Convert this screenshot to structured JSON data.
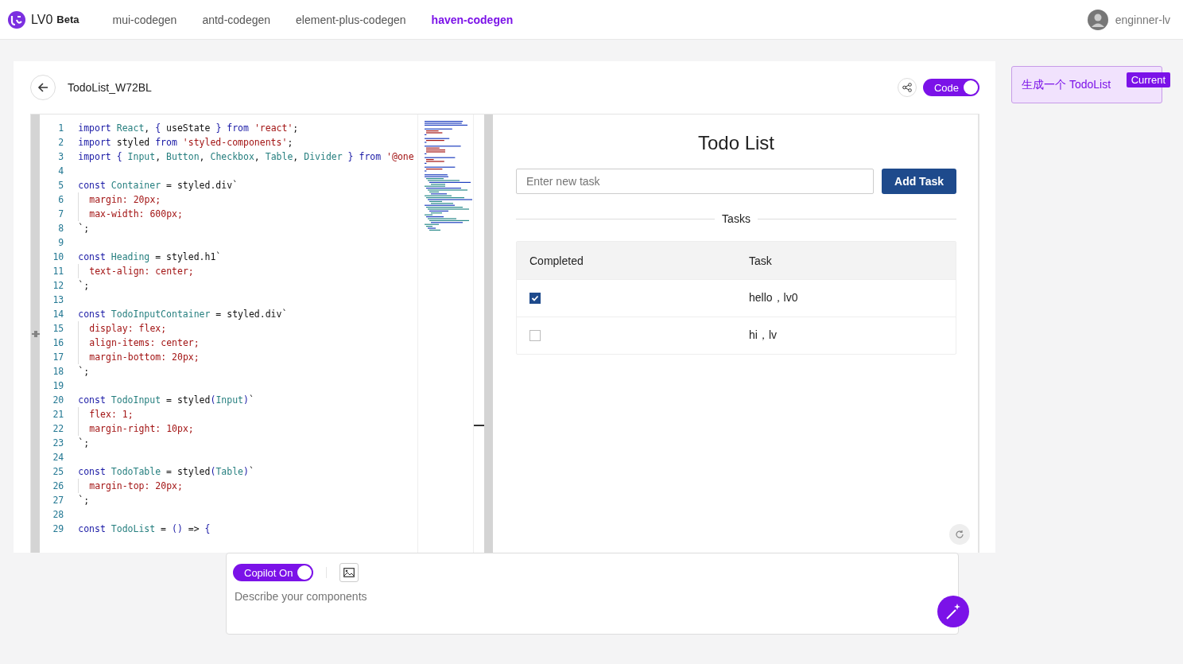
{
  "header": {
    "logo_text": "LV0",
    "logo_badge": "Beta",
    "nav": [
      {
        "label": "mui-codegen",
        "selected": false
      },
      {
        "label": "antd-codegen",
        "selected": false
      },
      {
        "label": "element-plus-codegen",
        "selected": false
      },
      {
        "label": "haven-codegen",
        "selected": true
      }
    ],
    "user": {
      "name": "enginner-lv"
    }
  },
  "workspace": {
    "title": "TodoList_W72BL",
    "code_toggle": {
      "label": "Code",
      "on": true
    },
    "editor": {
      "lines": [
        {
          "n": "1",
          "guide": false,
          "tokens": [
            {
              "kind": "keyword",
              "text": "import"
            },
            {
              "kind": "type",
              "text": " React"
            },
            {
              "kind": "plain",
              "text": ", "
            },
            {
              "kind": "keyword",
              "text": "{"
            },
            {
              "kind": "plain",
              "text": " useState "
            },
            {
              "kind": "keyword",
              "text": "}"
            },
            {
              "kind": "keyword",
              "text": " from"
            },
            {
              "kind": "string",
              "text": " 'react'"
            },
            {
              "kind": "plain",
              "text": ";"
            }
          ]
        },
        {
          "n": "2",
          "guide": false,
          "tokens": [
            {
              "kind": "keyword",
              "text": "import"
            },
            {
              "kind": "plain",
              "text": " styled "
            },
            {
              "kind": "keyword",
              "text": "from"
            },
            {
              "kind": "string",
              "text": " 'styled-components'"
            },
            {
              "kind": "plain",
              "text": ";"
            }
          ]
        },
        {
          "n": "3",
          "guide": false,
          "tokens": [
            {
              "kind": "keyword",
              "text": "import"
            },
            {
              "kind": "keyword",
              "text": " {"
            },
            {
              "kind": "type",
              "text": " Input"
            },
            {
              "kind": "plain",
              "text": ", "
            },
            {
              "kind": "type",
              "text": "Button"
            },
            {
              "kind": "plain",
              "text": ", "
            },
            {
              "kind": "type",
              "text": "Checkbox"
            },
            {
              "kind": "plain",
              "text": ", "
            },
            {
              "kind": "type",
              "text": "Table"
            },
            {
              "kind": "plain",
              "text": ", "
            },
            {
              "kind": "type",
              "text": "Divider"
            },
            {
              "kind": "keyword",
              "text": " }"
            },
            {
              "kind": "keyword",
              "text": " from"
            },
            {
              "kind": "string",
              "text": " '@one"
            }
          ]
        },
        {
          "n": "4",
          "guide": false
        },
        {
          "n": "5",
          "guide": false,
          "tokens": [
            {
              "kind": "keyword",
              "text": "const"
            },
            {
              "kind": "type",
              "text": " Container"
            },
            {
              "kind": "plain",
              "text": " = styled.div`"
            }
          ]
        },
        {
          "n": "6",
          "guide": true,
          "tokens": [
            {
              "kind": "string",
              "text": "margin: 20px;"
            }
          ]
        },
        {
          "n": "7",
          "guide": true,
          "tokens": [
            {
              "kind": "string",
              "text": "max-width: 600px;"
            }
          ]
        },
        {
          "n": "8",
          "guide": false,
          "tokens": [
            {
              "kind": "plain",
              "text": "`;"
            }
          ]
        },
        {
          "n": "9",
          "guide": false
        },
        {
          "n": "10",
          "guide": false,
          "tokens": [
            {
              "kind": "keyword",
              "text": "const"
            },
            {
              "kind": "type",
              "text": " Heading"
            },
            {
              "kind": "plain",
              "text": " = styled.h1`"
            }
          ]
        },
        {
          "n": "11",
          "guide": true,
          "tokens": [
            {
              "kind": "string",
              "text": "text-align: center;"
            }
          ]
        },
        {
          "n": "12",
          "guide": false,
          "tokens": [
            {
              "kind": "plain",
              "text": "`;"
            }
          ]
        },
        {
          "n": "13",
          "guide": false
        },
        {
          "n": "14",
          "guide": false,
          "tokens": [
            {
              "kind": "keyword",
              "text": "const"
            },
            {
              "kind": "type",
              "text": " TodoInputContainer"
            },
            {
              "kind": "plain",
              "text": " = styled.div`"
            }
          ]
        },
        {
          "n": "15",
          "guide": true,
          "tokens": [
            {
              "kind": "string",
              "text": "display: flex;"
            }
          ]
        },
        {
          "n": "16",
          "guide": true,
          "tokens": [
            {
              "kind": "string",
              "text": "align-items: center;"
            }
          ]
        },
        {
          "n": "17",
          "guide": true,
          "tokens": [
            {
              "kind": "string",
              "text": "margin-bottom: 20px;"
            }
          ]
        },
        {
          "n": "18",
          "guide": false,
          "tokens": [
            {
              "kind": "plain",
              "text": "`;"
            }
          ]
        },
        {
          "n": "19",
          "guide": false
        },
        {
          "n": "20",
          "guide": false,
          "tokens": [
            {
              "kind": "keyword",
              "text": "const"
            },
            {
              "kind": "type",
              "text": " TodoInput"
            },
            {
              "kind": "plain",
              "text": " = styled"
            },
            {
              "kind": "keyword",
              "text": "("
            },
            {
              "kind": "type",
              "text": "Input"
            },
            {
              "kind": "keyword",
              "text": ")"
            },
            {
              "kind": "plain",
              "text": "`"
            }
          ]
        },
        {
          "n": "21",
          "guide": true,
          "tokens": [
            {
              "kind": "string",
              "text": "flex: 1;"
            }
          ]
        },
        {
          "n": "22",
          "guide": true,
          "tokens": [
            {
              "kind": "string",
              "text": "margin-right: 10px;"
            }
          ]
        },
        {
          "n": "23",
          "guide": false,
          "tokens": [
            {
              "kind": "plain",
              "text": "`;"
            }
          ]
        },
        {
          "n": "24",
          "guide": false
        },
        {
          "n": "25",
          "guide": false,
          "tokens": [
            {
              "kind": "keyword",
              "text": "const"
            },
            {
              "kind": "type",
              "text": " TodoTable"
            },
            {
              "kind": "plain",
              "text": " = styled"
            },
            {
              "kind": "keyword",
              "text": "("
            },
            {
              "kind": "type",
              "text": "Table"
            },
            {
              "kind": "keyword",
              "text": ")"
            },
            {
              "kind": "plain",
              "text": "`"
            }
          ]
        },
        {
          "n": "26",
          "guide": true,
          "tokens": [
            {
              "kind": "string",
              "text": "margin-top: 20px;"
            }
          ]
        },
        {
          "n": "27",
          "guide": false,
          "tokens": [
            {
              "kind": "plain",
              "text": "`;"
            }
          ]
        },
        {
          "n": "28",
          "guide": false
        },
        {
          "n": "29",
          "guide": false,
          "tokens": [
            {
              "kind": "keyword",
              "text": "const"
            },
            {
              "kind": "type",
              "text": " TodoList"
            },
            {
              "kind": "plain",
              "text": " = "
            },
            {
              "kind": "keyword",
              "text": "()"
            },
            {
              "kind": "plain",
              "text": " => "
            },
            {
              "kind": "keyword",
              "text": "{"
            }
          ]
        }
      ]
    },
    "preview": {
      "heading": "Todo List",
      "task_input": {
        "placeholder": "Enter new task"
      },
      "add_button": "Add Task",
      "divider": "Tasks",
      "table": {
        "columns": [
          "Completed",
          "Task"
        ],
        "rows": [
          {
            "checked": true,
            "task": "hello，lv0"
          },
          {
            "checked": false,
            "task": "hi，lv"
          }
        ]
      }
    }
  },
  "history": [
    {
      "prompt": "生成一个 TodoList",
      "badge": "Current",
      "selected": true
    }
  ],
  "prompt_box": {
    "copilot_toggle": {
      "label": "Copilot On",
      "on": true
    },
    "placeholder": "Describe your components"
  }
}
